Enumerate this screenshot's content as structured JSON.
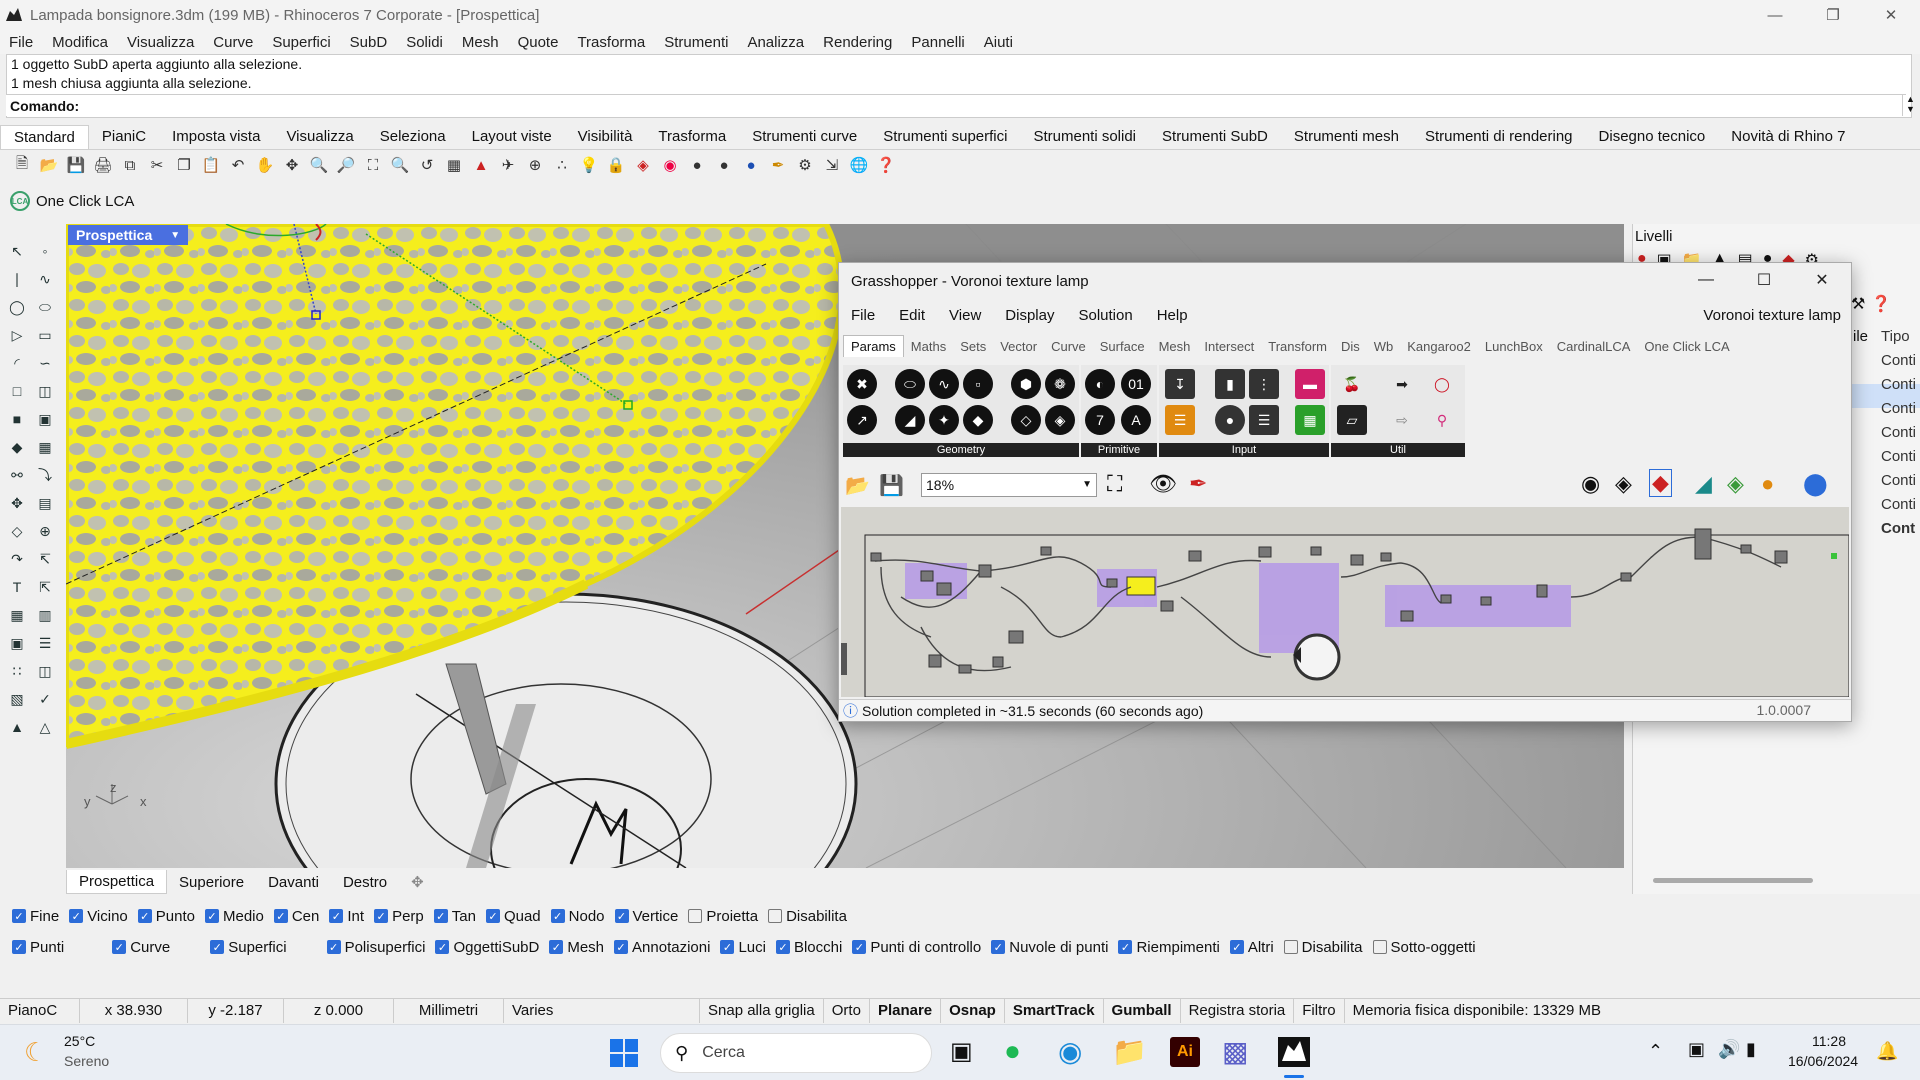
{
  "window": {
    "title": "Lampada bonsignore.3dm (199 MB) - Rhinoceros 7 Corporate - [Prospettica]"
  },
  "menu": [
    "File",
    "Modifica",
    "Visualizza",
    "Curve",
    "Superfici",
    "SubD",
    "Solidi",
    "Mesh",
    "Quote",
    "Trasforma",
    "Strumenti",
    "Analizza",
    "Rendering",
    "Pannelli",
    "Aiuti"
  ],
  "command": {
    "history": [
      "1 oggetto SubD aperta aggiunto alla selezione.",
      "1 mesh chiusa aggiunta alla selezione."
    ],
    "prompt": "Comando:"
  },
  "tabs": [
    "Standard",
    "PianiC",
    "Imposta vista",
    "Visualizza",
    "Seleziona",
    "Layout viste",
    "Visibilità",
    "Trasforma",
    "Strumenti curve",
    "Strumenti superfici",
    "Strumenti solidi",
    "Strumenti SubD",
    "Strumenti mesh",
    "Strumenti di rendering",
    "Disegno tecnico",
    "Novità di Rhino 7"
  ],
  "plugin_bar": {
    "label": "One Click LCA",
    "icon_text": "LCA"
  },
  "viewport": {
    "label": "Prospettica",
    "tabs": [
      "Prospettica",
      "Superiore",
      "Davanti",
      "Destro"
    ],
    "axes": {
      "x": "x",
      "y": "y",
      "z": "z"
    }
  },
  "layers_panel": {
    "title": "Livelli",
    "column_partial": "ile",
    "column_tipo": "Tipo",
    "rows": [
      "Conti",
      "Conti",
      "Conti",
      "Conti",
      "Conti",
      "Conti",
      "Conti",
      "Cont"
    ]
  },
  "osnap": [
    {
      "label": "Fine",
      "on": true
    },
    {
      "label": "Vicino",
      "on": true
    },
    {
      "label": "Punto",
      "on": true
    },
    {
      "label": "Medio",
      "on": true
    },
    {
      "label": "Cen",
      "on": true
    },
    {
      "label": "Int",
      "on": true
    },
    {
      "label": "Perp",
      "on": true
    },
    {
      "label": "Tan",
      "on": true
    },
    {
      "label": "Quad",
      "on": true
    },
    {
      "label": "Nodo",
      "on": true
    },
    {
      "label": "Vertice",
      "on": true
    },
    {
      "label": "Proietta",
      "on": false
    },
    {
      "label": "Disabilita",
      "on": false
    }
  ],
  "filters": [
    {
      "label": "Punti",
      "on": true
    },
    {
      "label": "Curve",
      "on": true
    },
    {
      "label": "Superfici",
      "on": true
    },
    {
      "label": "Polisuperfici",
      "on": true
    },
    {
      "label": "OggettiSubD",
      "on": true
    },
    {
      "label": "Mesh",
      "on": true
    },
    {
      "label": "Annotazioni",
      "on": true
    },
    {
      "label": "Luci",
      "on": true
    },
    {
      "label": "Blocchi",
      "on": true
    },
    {
      "label": "Punti di controllo",
      "on": true
    },
    {
      "label": "Nuvole di punti",
      "on": true
    },
    {
      "label": "Riempimenti",
      "on": true
    },
    {
      "label": "Altri",
      "on": true
    },
    {
      "label": "Disabilita",
      "on": false
    },
    {
      "label": "Sotto-oggetti",
      "on": false
    }
  ],
  "statusbar": {
    "plane": "PianoC",
    "x": "x 38.930",
    "y": "y -2.187",
    "z": "z 0.000",
    "units": "Millimetri",
    "layer": "Varies",
    "items": [
      {
        "label": "Snap alla griglia",
        "bold": false
      },
      {
        "label": "Orto",
        "bold": false
      },
      {
        "label": "Planare",
        "bold": true
      },
      {
        "label": "Osnap",
        "bold": true
      },
      {
        "label": "SmartTrack",
        "bold": true
      },
      {
        "label": "Gumball",
        "bold": true
      },
      {
        "label": "Registra storia",
        "bold": false
      },
      {
        "label": "Filtro",
        "bold": false
      }
    ],
    "memory": "Memoria fisica disponibile: 13329 MB"
  },
  "grasshopper": {
    "title": "Grasshopper - Voronoi texture lamp",
    "menu": [
      "File",
      "Edit",
      "View",
      "Display",
      "Solution",
      "Help"
    ],
    "document": "Voronoi texture lamp",
    "tabs": [
      "Params",
      "Maths",
      "Sets",
      "Vector",
      "Curve",
      "Surface",
      "Mesh",
      "Intersect",
      "Transform",
      "Dis",
      "Wb",
      "Kangaroo2",
      "LunchBox",
      "CardinalLCA",
      "One Click LCA"
    ],
    "groups": [
      "Geometry",
      "Primitive",
      "Input",
      "Util"
    ],
    "zoom": "18%",
    "status": "Solution completed in ~31.5 seconds (60 seconds ago)",
    "version": "1.0.0007"
  },
  "taskbar": {
    "weather_temp": "25°C",
    "weather_desc": "Sereno",
    "search": "Cerca",
    "time": "11:28",
    "date": "16/06/2024"
  }
}
